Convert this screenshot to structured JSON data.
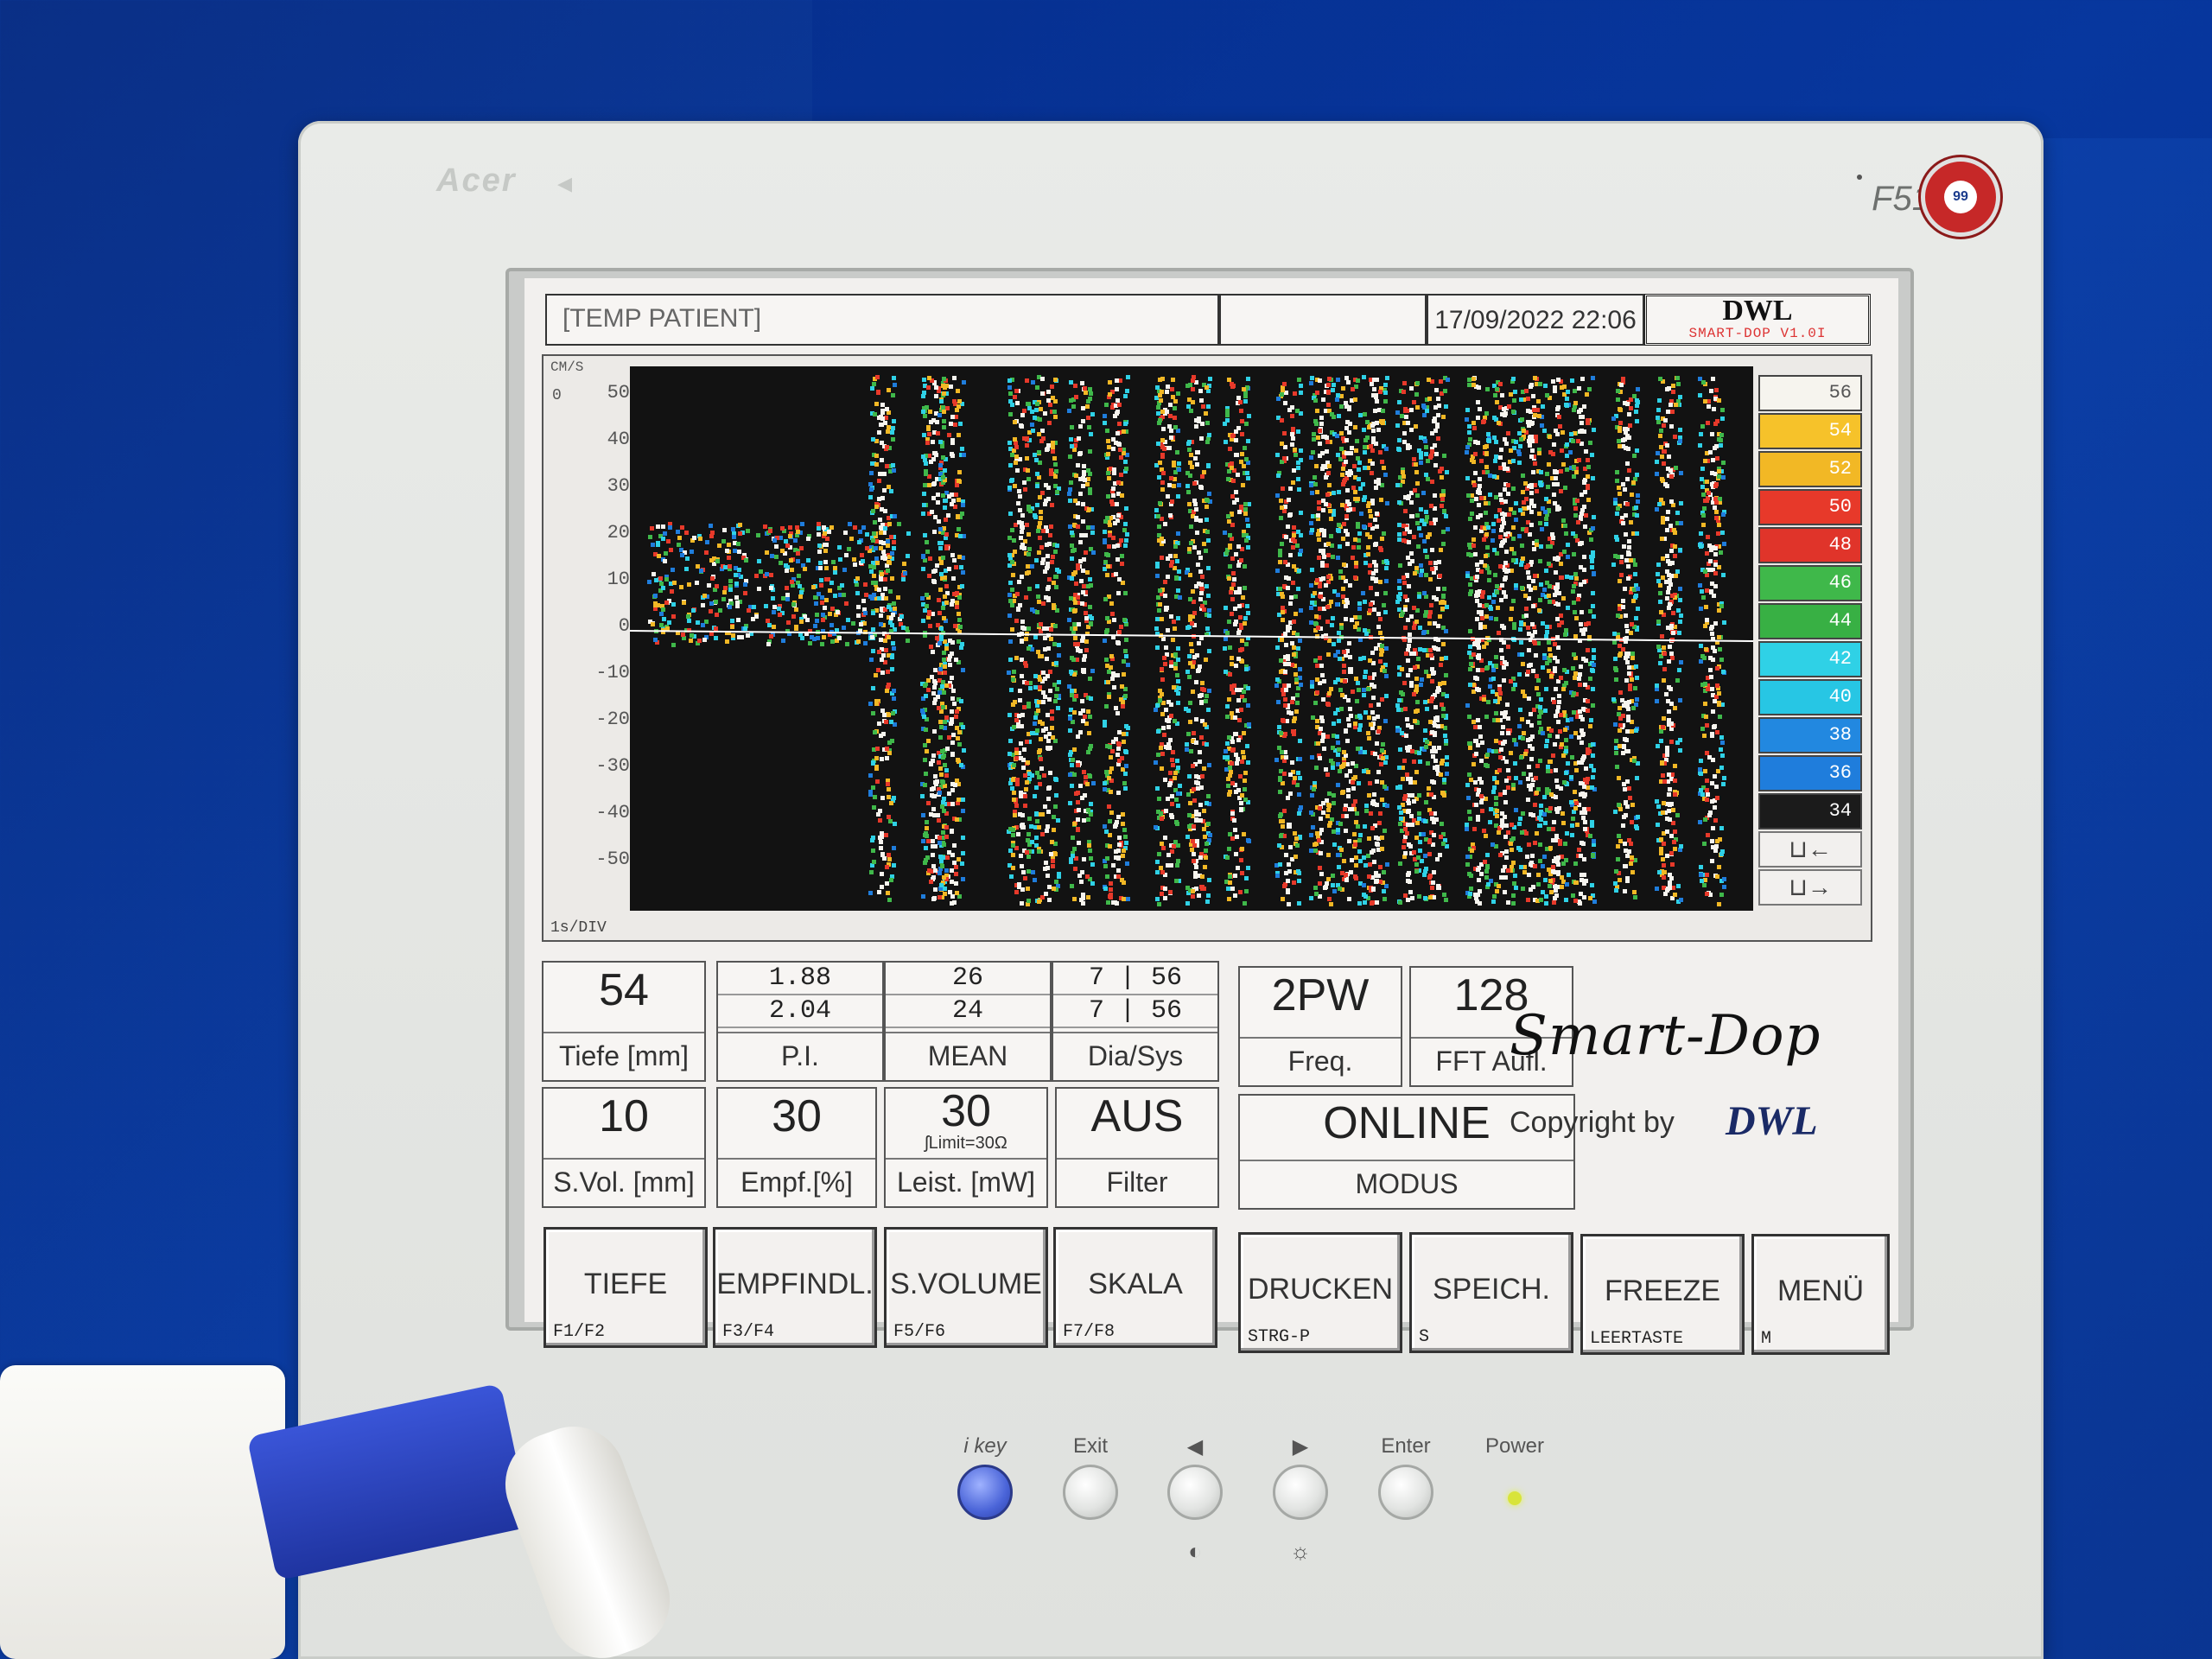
{
  "monitor": {
    "brand": "Acer",
    "model": "F51",
    "tco_label": "TCO 99"
  },
  "header": {
    "patient": "[TEMP PATIENT]",
    "datetime": "17/09/2022 22:06",
    "logo": "DWL",
    "version": "SMART-DOP V1.0I"
  },
  "spectrum": {
    "unit": "CM/S",
    "zero_label": "0",
    "time_div": "1s/DIV",
    "ticks": [
      "50",
      "40",
      "30",
      "20",
      "10",
      "0",
      "-10",
      "-20",
      "-30",
      "-40",
      "-50"
    ],
    "scale": [
      {
        "label": "56",
        "color": "#f6f4ee"
      },
      {
        "label": "54",
        "color": "#f6c22a"
      },
      {
        "label": "52",
        "color": "#f2b825"
      },
      {
        "label": "50",
        "color": "#e7392a"
      },
      {
        "label": "48",
        "color": "#e0342a"
      },
      {
        "label": "46",
        "color": "#3fb84a"
      },
      {
        "label": "44",
        "color": "#38b044"
      },
      {
        "label": "42",
        "color": "#2fd1e6"
      },
      {
        "label": "40",
        "color": "#27c6e4"
      },
      {
        "label": "38",
        "color": "#2288e0"
      },
      {
        "label": "36",
        "color": "#1f7ddc"
      },
      {
        "label": "34",
        "color": "#1b1b1b"
      }
    ],
    "scale_arrows": [
      "⊔←",
      "⊔→"
    ]
  },
  "params": {
    "tiefe": {
      "value": "54",
      "label": "Tiefe [mm]"
    },
    "pi": {
      "top": "1.88",
      "bottom": "2.04",
      "label": "P.I."
    },
    "mean": {
      "top": "26",
      "bottom": "24",
      "label": "MEAN"
    },
    "dia_sys": {
      "top": "7 | 56",
      "bottom": "7 | 56",
      "label": "Dia/Sys"
    },
    "freq": {
      "value": "2PW",
      "label": "Freq."
    },
    "fft": {
      "value": "128",
      "label": "FFT Aufl."
    },
    "svol": {
      "value": "10",
      "label": "S.Vol. [mm]"
    },
    "empf": {
      "value": "30",
      "label": "Empf.[%]"
    },
    "leist": {
      "value": "30",
      "limit": "ʃLimit=30Ω",
      "label": "Leist. [mW]"
    },
    "filter": {
      "value": "AUS",
      "label": "Filter"
    },
    "modus": {
      "value": "ONLINE",
      "label": "MODUS"
    }
  },
  "branding": {
    "product": "Smart-Dop",
    "copyright": "Copyright by",
    "company": "DWL"
  },
  "buttons": [
    {
      "label": "TIEFE",
      "key": "F1/F2"
    },
    {
      "label": "EMPFINDL.",
      "key": "F3/F4"
    },
    {
      "label": "S.VOLUME",
      "key": "F5/F6"
    },
    {
      "label": "SKALA",
      "key": "F7/F8"
    },
    {
      "label": "DRUCKEN",
      "key": "STRG-P"
    },
    {
      "label": "SPEICH.",
      "key": "S"
    },
    {
      "label": "FREEZE",
      "key": "LEERTASTE"
    },
    {
      "label": "MENÜ",
      "key": "M"
    }
  ],
  "hardware": {
    "ikey": "i key",
    "exit": "Exit",
    "left": "◀",
    "right": "▶",
    "enter": "Enter",
    "power": "Power",
    "contrast": "◐",
    "brightness": "☼"
  }
}
